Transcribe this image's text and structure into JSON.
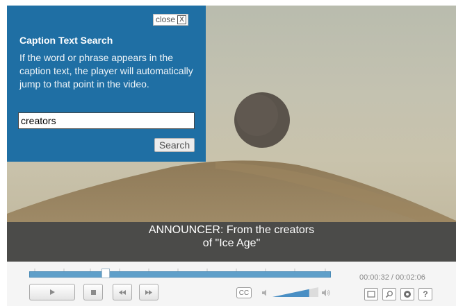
{
  "search_panel": {
    "close_label": "close",
    "close_icon_glyph": "X",
    "title": "Caption Text Search",
    "description": "If the word or phrase appears in the caption text, the player will automatically jump to that point in the video.",
    "search_value": "creators",
    "search_button_label": "Search"
  },
  "caption": {
    "text": "ANNOUNCER: From the creators\nof \"Ice Age\""
  },
  "controls": {
    "playback_fraction": 0.254,
    "time_current": "00:00:32",
    "time_separator": " / ",
    "time_total": "00:02:06",
    "cc_label": "CC",
    "volume_level": 0.8,
    "help_label": "?",
    "icons": [
      "play-icon",
      "stop-icon",
      "rewind-icon",
      "fast-forward-icon",
      "closed-captions-icon",
      "volume-low-icon",
      "volume-high-icon",
      "fullscreen-icon",
      "search-icon",
      "settings-icon",
      "help-icon"
    ]
  },
  "colors": {
    "panel_bg": "#1f6fa4",
    "caption_bar": "#4b4b49",
    "seek_fill": "#5f9fc9"
  }
}
